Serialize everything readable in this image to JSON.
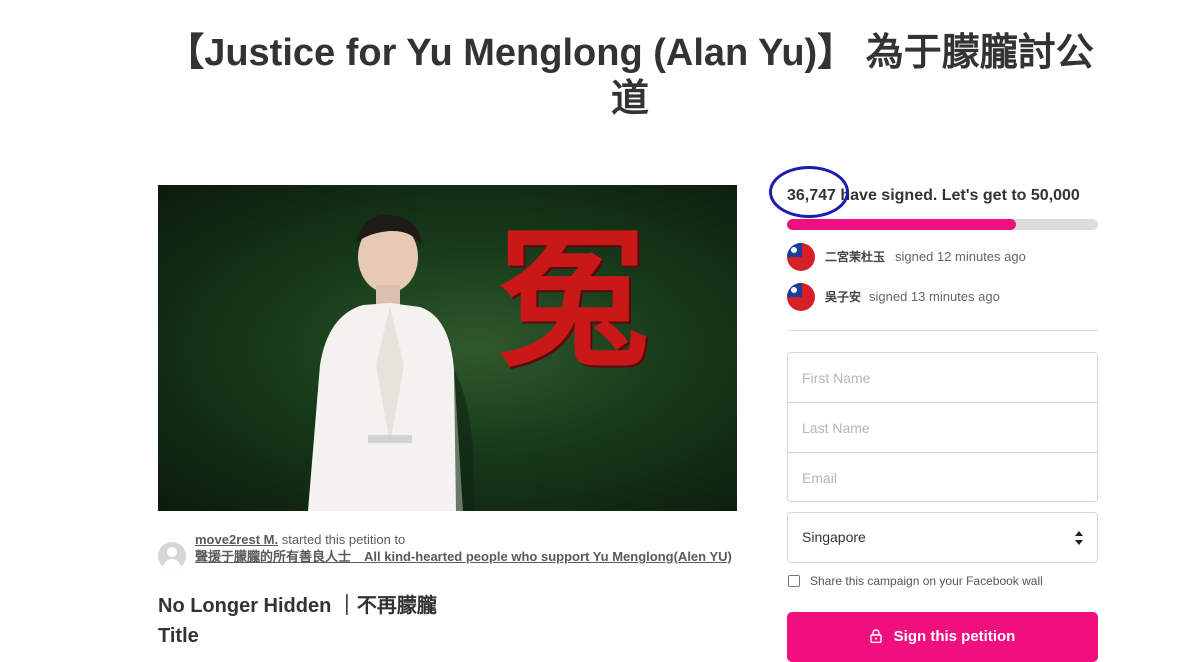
{
  "page": {
    "title": "【Justice for Yu Menglong (Alan Yu)】 為于朦朧討公道"
  },
  "hero": {
    "image_alt": "Man in white suit beside red character on green background",
    "character": "冤"
  },
  "starter": {
    "name": "move2rest M.",
    "action": "started this petition to",
    "recipient": "聲援于朦朧的所有善良人士　All kind-hearted people who support Yu Menglong(Alen YU)"
  },
  "content": {
    "subtitle": "No Longer Hidden ｜不再朦朧",
    "section_title": "Title"
  },
  "sidebar": {
    "count": "36,747",
    "count_suffix": " have signed. Let's get to 50,000",
    "progress": 0.7349,
    "accent_color": "#ef0f7e",
    "highlight_circle_color": "#1c1cb0",
    "signers": [
      {
        "name": "二宮茉杜玉",
        "text": "signed 12 minutes ago",
        "flag": "taiwan-flag-icon"
      },
      {
        "name": "吳子安",
        "text": "signed 13 minutes ago",
        "flag": "taiwan-flag-icon"
      }
    ]
  },
  "form": {
    "first_name_placeholder": "First Name",
    "last_name_placeholder": "Last Name",
    "email_placeholder": "Email",
    "country": "Singapore",
    "share_label": "Share this campaign on your Facebook wall",
    "sign_button": "Sign this petition"
  }
}
